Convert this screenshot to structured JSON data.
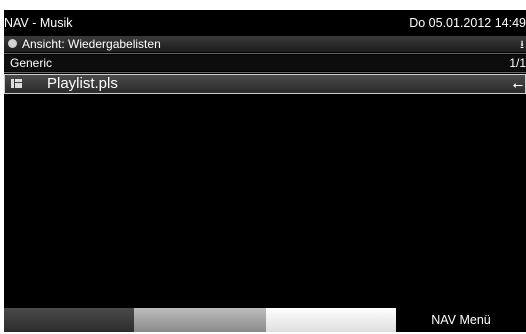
{
  "title_bar": {
    "app": "NAV - Musik",
    "datetime": "Do 05.01.2012  14:49"
  },
  "view": {
    "label": "Ansicht: Wiedergabelisten",
    "icon": "download-icon",
    "icon_glyph": "⭳"
  },
  "group": {
    "label": "Generic",
    "page": "1/1"
  },
  "items": [
    {
      "name": "Playlist.pls",
      "type_icon": "playlist-file-icon",
      "source_icon": "usb-icon",
      "source_glyph": "⭠"
    }
  ],
  "bottom_bar": {
    "button4_label": "NAV Menü"
  }
}
